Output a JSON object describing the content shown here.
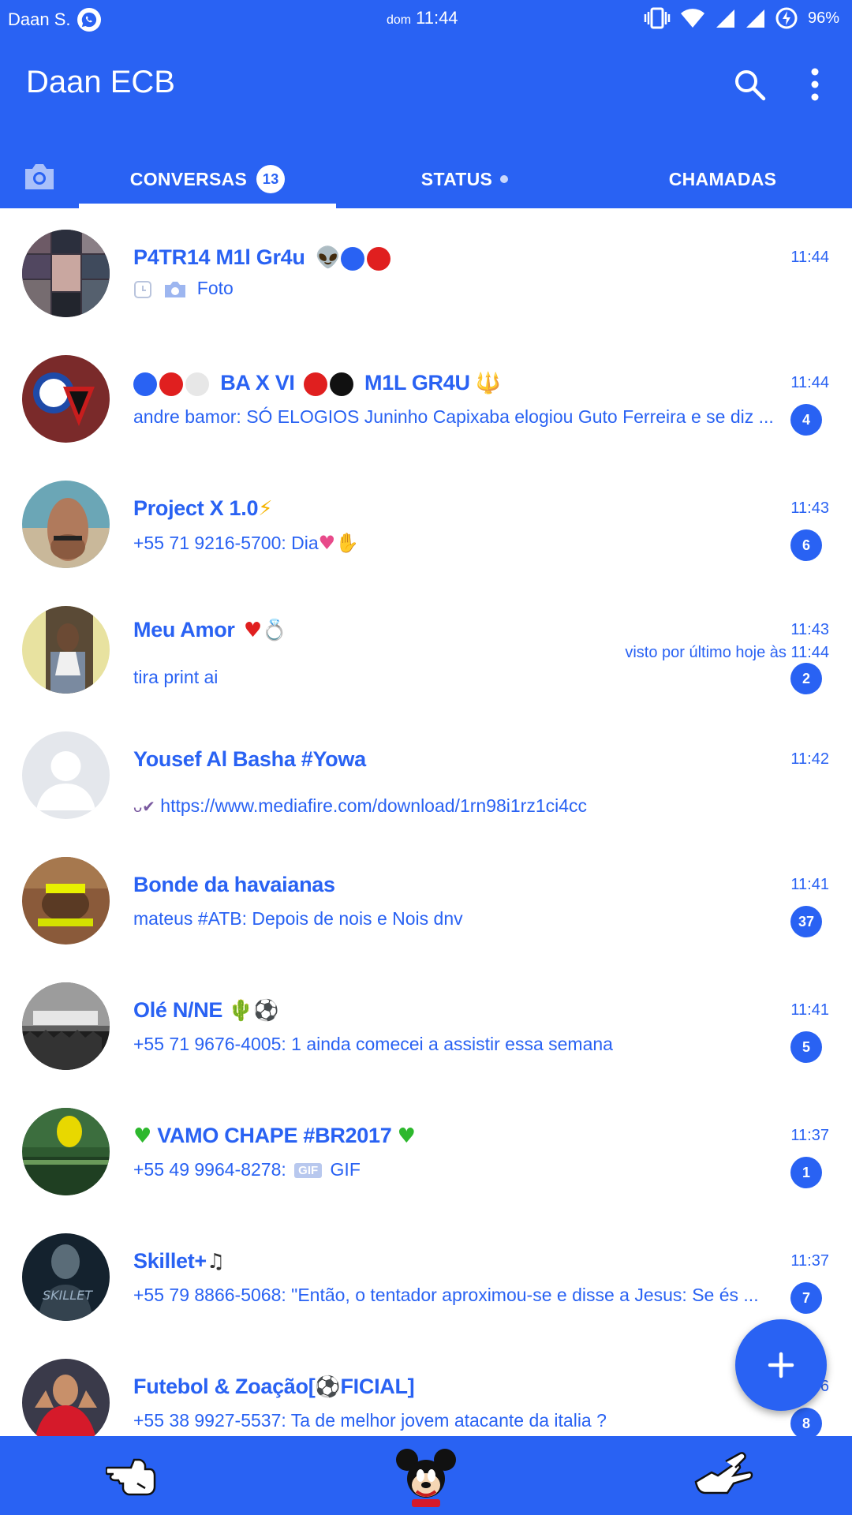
{
  "statusbar": {
    "carrier": "Daan S.",
    "day": "dom",
    "time": "11:44",
    "battery": "96%"
  },
  "appbar": {
    "title": "Daan ECB"
  },
  "tabs": {
    "conversas": "CONVERSAS",
    "conversas_badge": "13",
    "status": "STATUS",
    "chamadas": "CHAMADAS"
  },
  "chats": [
    {
      "name": "P4TR14 M1l Gr4u",
      "time": "11:44",
      "preview": "Foto",
      "unread": ""
    },
    {
      "name": "BA X VI",
      "name_suffix": "M1L GR4U",
      "time": "11:44",
      "preview": "andre bamor: SÓ ELOGIOS Juninho Capixaba elogiou Guto Ferreira e se diz ...",
      "unread": "4"
    },
    {
      "name": "Project X 1.0",
      "time": "11:43",
      "preview": "+55 71 9216-5700: Dia",
      "unread": "6"
    },
    {
      "name": "Meu Amor",
      "time": "11:43",
      "status": "visto por último hoje às 11:44",
      "preview": "tira print ai",
      "unread": "2"
    },
    {
      "name": "Yousef Al Basha #Yowa",
      "time": "11:42",
      "preview": "https://www.mediafire.com/download/1rn98i1rz1ci4cc",
      "unread": ""
    },
    {
      "name": "Bonde da havaianas",
      "time": "11:41",
      "preview": "mateus #ATB: Depois de nois e Nois dnv",
      "unread": "37"
    },
    {
      "name": "Olé N/NE",
      "time": "11:41",
      "preview": "+55 71 9676-4005: 1 ainda comecei a assistir essa semana",
      "unread": "5"
    },
    {
      "name": "VAMO CHAPE #BR2017",
      "time": "11:37",
      "preview": "+55 49 9964-8278:",
      "preview_gif_tag": "GIF",
      "preview_suffix": "GIF",
      "unread": "1"
    },
    {
      "name": "Skillet+",
      "time": "11:37",
      "preview": "+55 79 8866-5068: \"Então, o tentador aproximou-se e disse a Jesus: Se és ...",
      "unread": "7"
    },
    {
      "name": "Futebol & Zoação[",
      "name_suffix": "FICIAL]",
      "time": "11:36",
      "preview": "+55 38 9927-5537: Ta de melhor jovem atacante da italia ?",
      "unread": "8"
    }
  ],
  "colors": {
    "primary": "#2962f3",
    "background": "#ffffff"
  }
}
